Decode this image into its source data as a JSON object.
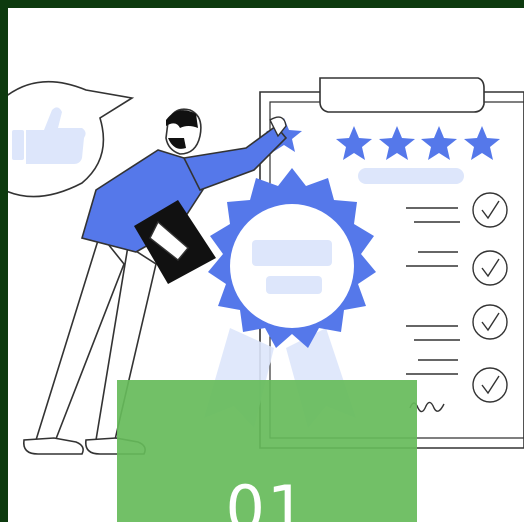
{
  "overlay": {
    "step_number": "01"
  },
  "colors": {
    "outer_border": "#0d3a0e",
    "accent_blue": "#5578ea",
    "light_blue": "#dde6fb",
    "overlay_green": "#66bb5a",
    "line_gray": "#333333"
  },
  "icons": {
    "thumbs_up": "thumbs-up-icon",
    "checkmark": "check-circle-icon",
    "star": "star-icon"
  },
  "checklist": {
    "rating_stars": 5,
    "checked_items": 4
  }
}
